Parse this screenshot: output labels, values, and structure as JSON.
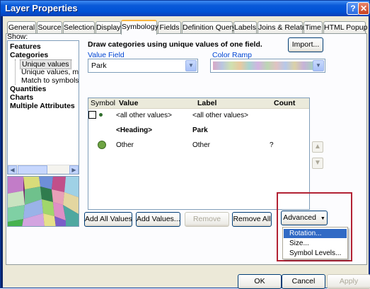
{
  "window": {
    "title": "Layer Properties",
    "help_glyph": "?",
    "close_glyph": "✕"
  },
  "tabs": [
    {
      "label": "General"
    },
    {
      "label": "Source"
    },
    {
      "label": "Selection"
    },
    {
      "label": "Display"
    },
    {
      "label": "Symbology",
      "active": true
    },
    {
      "label": "Fields"
    },
    {
      "label": "Definition Query"
    },
    {
      "label": "Labels"
    },
    {
      "label": "Joins & Relates"
    },
    {
      "label": "Time"
    },
    {
      "label": "HTML Popup"
    }
  ],
  "show": {
    "label": "Show:",
    "items": [
      "Features",
      "Categories",
      "Unique values",
      "Unique values, many",
      "Match to symbols in a",
      "Quantities",
      "Charts",
      "Multiple Attributes"
    ],
    "selected": "Unique values"
  },
  "symbology": {
    "description": "Draw categories using unique values of one field.",
    "import_label": "Import...",
    "value_field": {
      "label": "Value Field",
      "value": "Park"
    },
    "color_ramp": {
      "label": "Color Ramp"
    }
  },
  "table": {
    "headers": {
      "symbol": "Symbol",
      "value": "Value",
      "label": "Label",
      "count": "Count"
    },
    "rows": [
      {
        "value": "<all other values>",
        "label": "<all other values>",
        "count": ""
      },
      {
        "value": "<Heading>",
        "label": "Park",
        "count": ""
      },
      {
        "value": "Other",
        "label": "Other",
        "count": "?"
      }
    ]
  },
  "buttons": {
    "add_all_values": "Add All Values",
    "add_values": "Add Values...",
    "remove": "Remove",
    "remove_all": "Remove All",
    "advanced": "Advanced"
  },
  "advanced_menu": {
    "items": [
      "Rotation...",
      "Size...",
      "Symbol Levels..."
    ],
    "highlighted": "Rotation..."
  },
  "dialog": {
    "ok": "OK",
    "cancel": "Cancel",
    "apply": "Apply"
  },
  "icons": {
    "move_up": "up-arrow-icon",
    "move_down": "down-arrow-icon",
    "dropdown": "chevron-down-icon"
  },
  "colors": {
    "title_bar": "#0a5ad8",
    "highlight_box": "#b22234",
    "menu_highlight": "#316ac5",
    "symbol_other": "#6ea443"
  }
}
